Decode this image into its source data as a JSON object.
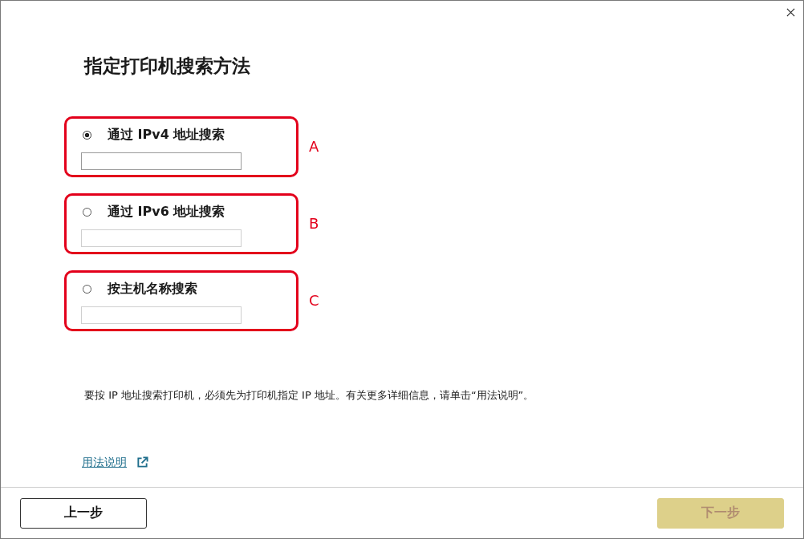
{
  "title": "指定打印机搜索方法",
  "options": [
    {
      "label": "通过 IPv4 地址搜索",
      "selected": true,
      "marker": "A"
    },
    {
      "label": "通过 IPv6 地址搜索",
      "selected": false,
      "marker": "B"
    },
    {
      "label": "按主机名称搜索",
      "selected": false,
      "marker": "C"
    }
  ],
  "note": "要按 IP 地址搜索打印机，必须先为打印机指定 IP 地址。有关更多详细信息，请单击“用法说明”。",
  "help_link": {
    "label": "用法说明"
  },
  "footer": {
    "buttons": [
      {
        "label": "上一步",
        "disabled": false
      },
      {
        "label": "下一步",
        "disabled": true
      }
    ]
  }
}
